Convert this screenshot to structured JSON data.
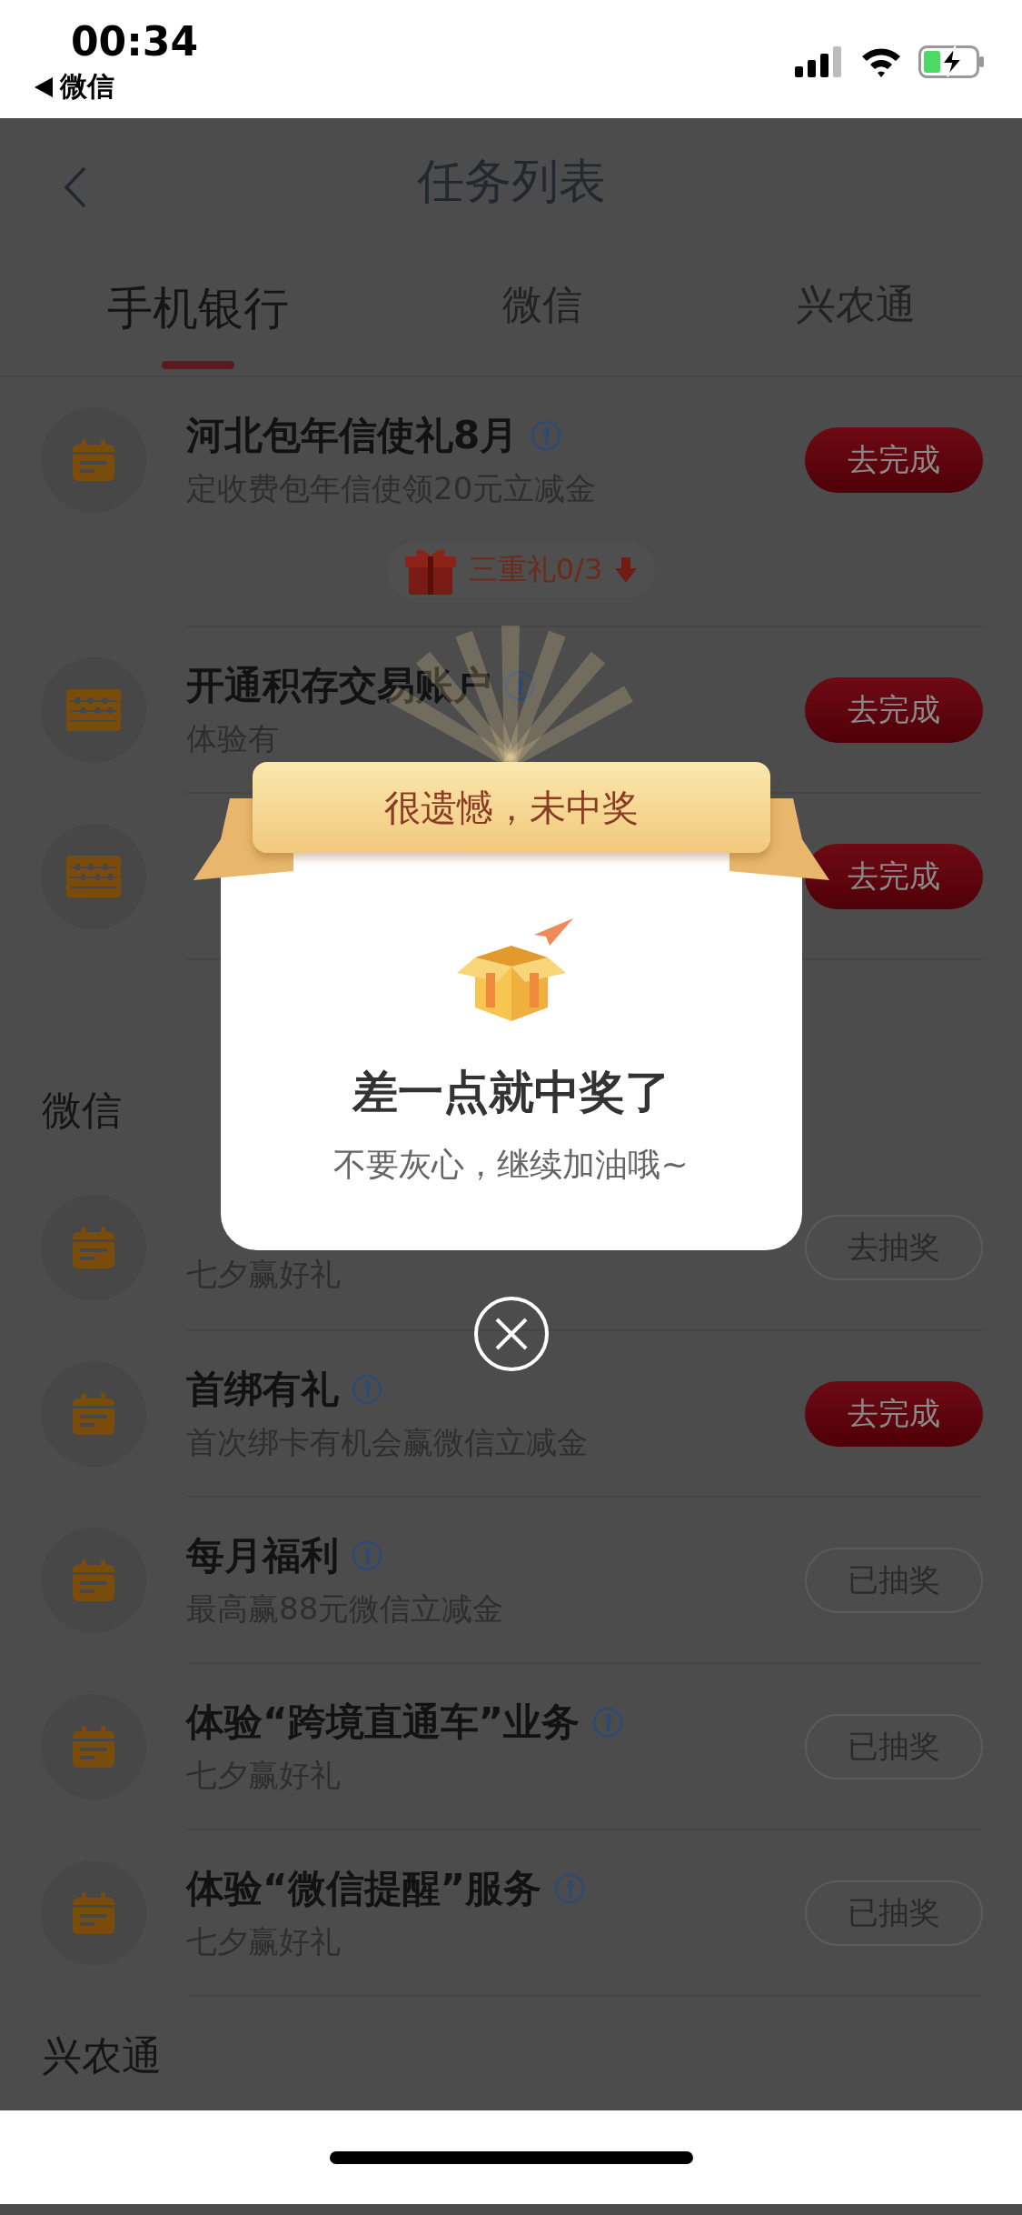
{
  "status_bar": {
    "time": "00:34",
    "back_app": "微信"
  },
  "header": {
    "title": "任务列表"
  },
  "tabs": [
    {
      "label": "手机银行",
      "selected": true
    },
    {
      "label": "微信",
      "selected": false
    },
    {
      "label": "兴农通",
      "selected": false
    }
  ],
  "sections": [
    {
      "tasks": [
        {
          "kind": "calendar",
          "title": "河北包年信使礼8月",
          "info": true,
          "subtitle": "定收费包年信使领20元立减金",
          "action": {
            "label": "去完成",
            "kind": "primary"
          },
          "gift": "三重礼0/3"
        },
        {
          "kind": "ledger",
          "title": "开通积存交易账户",
          "info": true,
          "subtitle": "体验有",
          "action": {
            "label": "去完成",
            "kind": "primary"
          }
        },
        {
          "kind": "ledger",
          "action": {
            "label": "去完成",
            "kind": "primary"
          }
        }
      ]
    },
    {
      "heading": "微信",
      "tasks": [
        {
          "kind": "calendar",
          "subtitle": "七夕赢好礼",
          "action": {
            "label": "去抽奖",
            "kind": "outline"
          }
        },
        {
          "kind": "calendar",
          "title": "首绑有礼",
          "info": true,
          "subtitle": "首次绑卡有机会赢微信立减金",
          "action": {
            "label": "去完成",
            "kind": "primary"
          }
        },
        {
          "kind": "calendar",
          "title": "每月福利",
          "info": true,
          "subtitle": "最高赢88元微信立减金",
          "action": {
            "label": "已抽奖",
            "kind": "outline"
          }
        },
        {
          "kind": "calendar",
          "title": "体验“跨境直通车”业务",
          "info": true,
          "subtitle": "七夕赢好礼",
          "action": {
            "label": "已抽奖",
            "kind": "outline"
          }
        },
        {
          "kind": "calendar",
          "title": "体验“微信提醒”服务",
          "info": true,
          "subtitle": "七夕赢好礼",
          "action": {
            "label": "已抽奖",
            "kind": "outline"
          }
        }
      ]
    },
    {
      "heading": "兴农通"
    }
  ],
  "modal": {
    "banner": "很遗憾，未中奖",
    "title": "差一点就中奖了",
    "message": "不要灰心，继续加油哦~"
  }
}
